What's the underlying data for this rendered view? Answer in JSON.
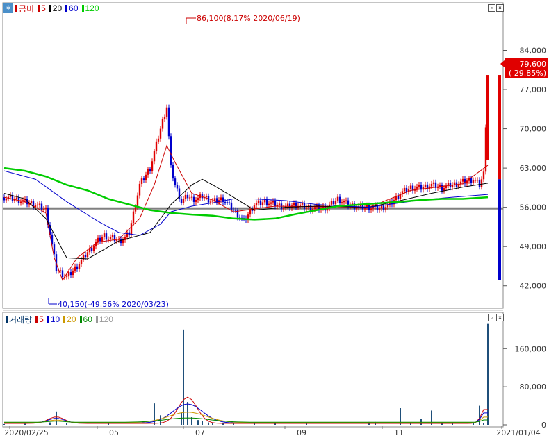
{
  "price_panel": {
    "legend": [
      {
        "label": "금비",
        "color": "#cc0000"
      },
      {
        "label": "5",
        "color": "#cc0000"
      },
      {
        "label": "20",
        "color": "#000000"
      },
      {
        "label": "60",
        "color": "#0000cc"
      },
      {
        "label": "120",
        "color": "#00cc00"
      }
    ],
    "high_annotation": "86,100(8.17% 2020/06/19)",
    "low_annotation": "40,150(-49.56% 2020/03/23)",
    "current_price": "79,600",
    "current_change": "( 29.85%)",
    "y_ticks": [
      "84,000",
      "77,000",
      "70,000",
      "63,000",
      "56,000",
      "49,000",
      "42,000"
    ],
    "ref_line_value": 55800,
    "colors": {
      "up": "#e00000",
      "down": "#0000cc",
      "ma5": "#cc0000",
      "ma20": "#000000",
      "ma60": "#0000cc",
      "ma120": "#00cc00",
      "ref": "#808080"
    }
  },
  "volume_panel": {
    "legend": [
      {
        "label": "거래량",
        "color": "#003366"
      },
      {
        "label": "5",
        "color": "#cc0000"
      },
      {
        "label": "10",
        "color": "#0000cc"
      },
      {
        "label": "20",
        "color": "#cc9900"
      },
      {
        "label": "60",
        "color": "#008800"
      },
      {
        "label": "120",
        "color": "#999999"
      }
    ],
    "y_ticks": [
      "160,000",
      "80,000",
      "0"
    ]
  },
  "x_labels": [
    "2020/02/25",
    "05",
    "07",
    "09",
    "11",
    "2021/01/04"
  ],
  "chart_data": [
    {
      "type": "line",
      "title": "금비",
      "y_ticks": [
        84000,
        77000,
        70000,
        63000,
        56000,
        49000,
        42000
      ],
      "ylim": [
        38500,
        90500
      ],
      "x_labels": [
        "2020/02/25",
        "05",
        "07",
        "09",
        "11",
        "2021/01/04"
      ],
      "series": [
        {
          "name": "금비",
          "x": [
            0,
            5,
            10,
            15,
            20,
            25,
            30,
            35,
            40,
            45,
            48,
            50,
            52,
            55,
            58,
            60,
            65,
            70,
            75,
            78,
            80,
            82,
            85,
            88,
            90,
            93,
            95,
            100,
            105,
            110,
            115,
            120,
            125,
            130,
            135,
            140,
            145,
            150,
            155,
            160,
            165,
            170,
            175,
            180,
            185,
            190,
            195,
            200,
            205,
            210,
            215,
            220,
            225,
            228,
            230,
            232
          ],
          "values": [
            57800,
            57500,
            57000,
            56500,
            55500,
            45000,
            43500,
            45500,
            48000,
            50000,
            51000,
            50500,
            50500,
            50000,
            50500,
            51500,
            60000,
            63000,
            70000,
            74000,
            63000,
            60000,
            57000,
            58000,
            57500,
            57500,
            58000,
            57000,
            57500,
            55500,
            53500,
            56500,
            57000,
            56500,
            56000,
            56500,
            56000,
            55800,
            56000,
            57500,
            56500,
            56000,
            56000,
            55800,
            56500,
            58500,
            59500,
            59500,
            60000,
            59500,
            60000,
            60500,
            61000,
            60000,
            62000,
            79600
          ]
        },
        {
          "name": "5",
          "x": [
            0,
            10,
            20,
            24,
            28,
            35,
            45,
            55,
            65,
            72,
            78,
            82,
            90,
            100,
            110,
            130,
            150,
            175,
            195,
            220,
            232
          ],
          "values": [
            57800,
            57000,
            55000,
            47000,
            43000,
            47000,
            49800,
            50300,
            54000,
            60000,
            67000,
            64000,
            58500,
            57300,
            55200,
            56200,
            56100,
            56000,
            59000,
            60200,
            63500
          ]
        },
        {
          "name": "20",
          "x": [
            0,
            10,
            20,
            30,
            40,
            55,
            70,
            80,
            90,
            95,
            100,
            110,
            120,
            135,
            150,
            175,
            190,
            205,
            220,
            232
          ],
          "values": [
            58500,
            57500,
            54000,
            47000,
            46800,
            50000,
            51500,
            56500,
            60000,
            61000,
            60000,
            57800,
            55500,
            56000,
            56200,
            56000,
            57200,
            58500,
            59600,
            60300
          ]
        },
        {
          "name": "60",
          "x": [
            0,
            15,
            30,
            45,
            55,
            65,
            75,
            80,
            90,
            100,
            110,
            120,
            135,
            150,
            175,
            190,
            200,
            215,
            232
          ],
          "values": [
            62500,
            61000,
            57000,
            53500,
            51500,
            51000,
            53000,
            55200,
            56200,
            56800,
            57500,
            57500,
            57200,
            56500,
            56000,
            56800,
            57300,
            57800,
            58300
          ]
        },
        {
          "name": "120",
          "x": [
            0,
            10,
            20,
            30,
            40,
            50,
            60,
            70,
            80,
            90,
            100,
            110,
            120,
            130,
            140,
            150,
            160,
            175,
            190,
            200,
            210,
            220,
            232
          ],
          "values": [
            63000,
            62500,
            61500,
            60000,
            59000,
            57500,
            56500,
            55500,
            55000,
            54700,
            54500,
            54000,
            53800,
            54000,
            54800,
            55500,
            56200,
            56600,
            57000,
            57300,
            57500,
            57500,
            57800
          ]
        }
      ]
    },
    {
      "type": "bar",
      "title": "거래량",
      "ylim": [
        0,
        210000
      ],
      "y_ticks": [
        160000,
        80000,
        0
      ],
      "x": [
        0,
        10,
        22,
        25,
        30,
        50,
        72,
        75,
        85,
        86,
        88,
        90,
        93,
        95,
        98,
        100,
        105,
        110,
        120,
        130,
        145,
        175,
        178,
        190,
        195,
        200,
        205,
        210,
        215,
        225,
        228,
        230,
        232
      ],
      "values": [
        1500,
        2000,
        5000,
        28000,
        4000,
        2500,
        45000,
        20000,
        25000,
        200000,
        48000,
        16000,
        10000,
        8000,
        5000,
        3000,
        3000,
        3000,
        3000,
        5000,
        4000,
        6000,
        6000,
        35000,
        4000,
        12000,
        30000,
        4000,
        3000,
        3000,
        40000,
        4000,
        212000
      ]
    }
  ]
}
